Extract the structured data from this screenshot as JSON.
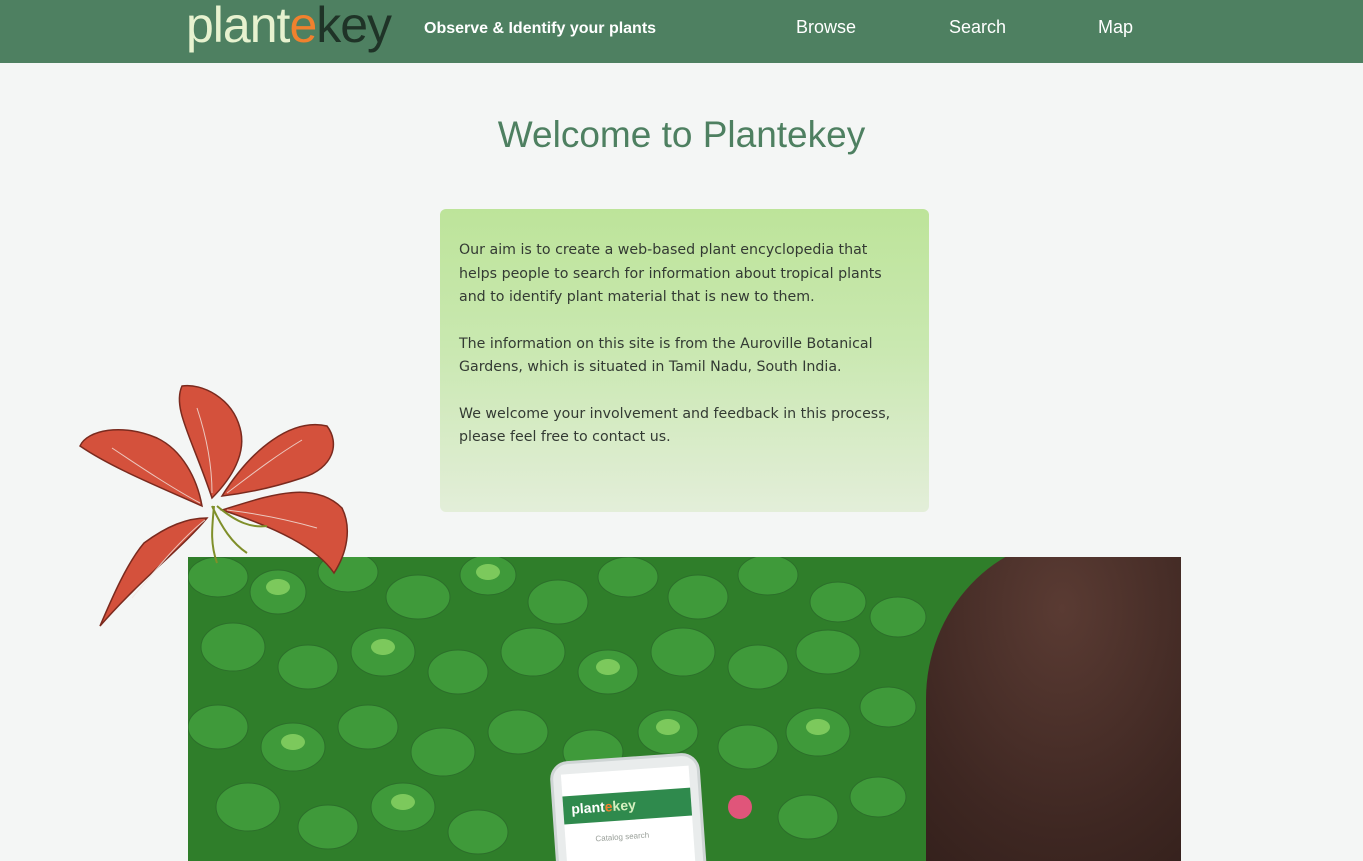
{
  "header": {
    "logo": {
      "part1": "plant",
      "part2": "e",
      "part3": "key"
    },
    "tagline": "Observe & Identify your plants",
    "nav": {
      "browse": "Browse",
      "search": "Search",
      "map": "Map"
    }
  },
  "main": {
    "title": "Welcome to Plantekey",
    "paragraphs": [
      "Our aim is to create a web-based plant encyclopedia that helps people to search for information about tropical plants and to identify plant material that is new to them.",
      "The information on this site is from the Auroville Botanical Gardens, which is situated in Tamil Nadu, South India.",
      "We welcome your involvement and feedback in this process, please feel free to contact us."
    ]
  },
  "photo": {
    "phone_logo": {
      "part1": "plant",
      "part2": "e",
      "part3": "key"
    },
    "phone_hint": "Catalog search"
  },
  "colors": {
    "header": "#4e8061",
    "title": "#4e8061",
    "accent": "#f0812e",
    "card": "#bde49a"
  }
}
